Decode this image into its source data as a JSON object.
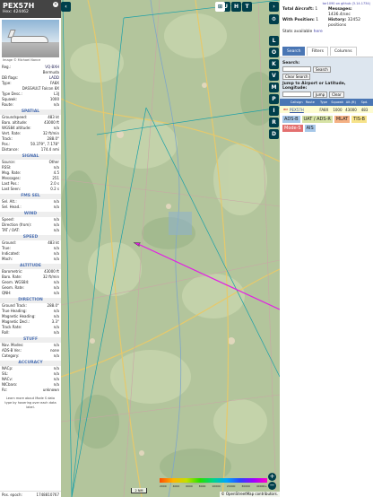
{
  "info": {
    "callsign": "PEX57H",
    "hex_label": "Hex:",
    "hex": "424462",
    "close_glyph": "×",
    "photo_credit": "Image © Michael Nance",
    "rows_top": [
      {
        "l": "Reg.:",
        "v": "VQ-BXH"
      },
      {
        "l": "",
        "v": "Bermuda"
      },
      {
        "l": "DB flags:",
        "v": "LADD"
      },
      {
        "l": "Type:",
        "v": "FA8X"
      },
      {
        "l": "",
        "v": "DASSAULT Falcon 8X"
      },
      {
        "l": "Type Desc.:",
        "v": "L3J"
      },
      {
        "l": "Squawk:",
        "v": "1000"
      },
      {
        "l": "Route:",
        "v": "n/a"
      }
    ],
    "sections": [
      {
        "title": "SPATIAL",
        "rows": [
          {
            "l": "Groundspeed:",
            "v": "483 kt"
          },
          {
            "l": "Baro. altitude:",
            "v": "43000 ft"
          },
          {
            "l": "WGS84 altitude:",
            "v": "n/a"
          },
          {
            "l": "Vert. Rate:",
            "v": "32 ft/min"
          },
          {
            "l": "Track:",
            "v": "288.0°"
          },
          {
            "l": "Pos.:",
            "v": "50.379°, 7.178°"
          },
          {
            "l": "Distance:",
            "v": "174.4 nmi"
          }
        ]
      },
      {
        "title": "SIGNAL",
        "rows": [
          {
            "l": "Source:",
            "v": "Other"
          },
          {
            "l": "RSSI:",
            "v": "n/a"
          },
          {
            "l": "Msg. Rate:",
            "v": "4.5"
          },
          {
            "l": "Messages:",
            "v": "251"
          },
          {
            "l": "Last Pos.:",
            "v": "2.0 s"
          },
          {
            "l": "Last Seen:",
            "v": "0.2 s"
          }
        ]
      },
      {
        "title": "FMS SEL",
        "rows": [
          {
            "l": "Sel. Alt.:",
            "v": "n/a"
          },
          {
            "l": "Sel. Head.:",
            "v": "n/a"
          }
        ]
      },
      {
        "title": "WIND",
        "rows": [
          {
            "l": "Speed:",
            "v": "n/a"
          },
          {
            "l": "Direction (from):",
            "v": "n/a"
          },
          {
            "l": "TAT / OAT:",
            "v": "n/a"
          }
        ]
      },
      {
        "title": "SPEED",
        "rows": [
          {
            "l": "Ground:",
            "v": "483 kt"
          },
          {
            "l": "True:",
            "v": "n/a"
          },
          {
            "l": "Indicated:",
            "v": "n/a"
          },
          {
            "l": "Mach:",
            "v": "n/a"
          }
        ]
      },
      {
        "title": "ALTITUDE",
        "rows": [
          {
            "l": "Barometric:",
            "v": "43000 ft"
          },
          {
            "l": "Baro. Rate:",
            "v": "32 ft/min"
          },
          {
            "l": "Geom. WGS84:",
            "v": "n/a"
          },
          {
            "l": "Geom. Rate:",
            "v": "n/a"
          },
          {
            "l": "QNH:",
            "v": "n/a"
          }
        ]
      },
      {
        "title": "DIRECTION",
        "rows": [
          {
            "l": "Ground Track:",
            "v": "288.0°"
          },
          {
            "l": "True Heading:",
            "v": "n/a"
          },
          {
            "l": "Magnetic Heading:",
            "v": "n/a"
          },
          {
            "l": "Magnetic Decl.:",
            "v": "3.3°"
          },
          {
            "l": "Track Rate:",
            "v": "n/a"
          },
          {
            "l": "Roll:",
            "v": "n/a"
          }
        ]
      },
      {
        "title": "STUFF",
        "rows": [
          {
            "l": "Nav. Modes:",
            "v": "n/a"
          },
          {
            "l": "ADS-B Ver.:",
            "v": "none"
          },
          {
            "l": "Category:",
            "v": "n/a"
          }
        ]
      },
      {
        "title": "ACCURACY",
        "rows": [
          {
            "l": "NACp:",
            "v": "n/a"
          },
          {
            "l": "SIL:",
            "v": "n/a"
          },
          {
            "l": "NACv:",
            "v": "n/a"
          },
          {
            "l": "NICbaro:",
            "v": "n/a"
          },
          {
            "l": "Rc:",
            "v": "unknown"
          }
        ]
      }
    ],
    "note": "Learn more about Mode S data type by hovering over each data label.",
    "foot_label": "Pos. epoch:",
    "foot_value": "1748810767"
  },
  "map": {
    "buttons_top": [
      "U",
      "H",
      "T"
    ],
    "buttons_right": [
      "L",
      "O",
      "K",
      "V",
      "M",
      "P",
      "I",
      "R",
      "D"
    ],
    "scale": "2 NM",
    "colorbar_labels": [
      "2000",
      "4000",
      "6000",
      "8000",
      "10000",
      "20000",
      "30000",
      "40000+"
    ],
    "attribution": "© OpenStreetMap contributors.",
    "zoom_in": "+",
    "zoom_out": "−",
    "colors": {
      "track": "#e21ee4",
      "route": "#1aa0a8"
    }
  },
  "side": {
    "top_link": "tar1090 on github (3.14.1734)",
    "stats": [
      {
        "k": "Total Aircraft:",
        "v": "1"
      },
      {
        "k": "Messages:",
        "v": "1436.4/sec"
      },
      {
        "k": "With Position:",
        "v": "1"
      },
      {
        "k": "History:",
        "v": "32452 positions"
      }
    ],
    "stats_available": "Stats available",
    "donate": "here",
    "tabs": [
      "Search",
      "Filters",
      "Columns"
    ],
    "search_label": "Search:",
    "search_button": "Search",
    "clear_search": "Clear Search",
    "jump_label": "Jump to Airport or Latitude, Longitude:",
    "jump_button": "Jump",
    "clear_button": "Clear",
    "columns": [
      "Callsign",
      "Route",
      "Type",
      "Squawk",
      "Alt.(ft)",
      "Spd."
    ],
    "row": {
      "flag": "BM",
      "callsign": "PEX57H",
      "type": "FA8X",
      "squawk": "1000",
      "alt": "43000",
      "spd": "483"
    },
    "badges": [
      "ADS-B",
      "UAT / ADS-R",
      "MLAT",
      "TIS-B",
      "Mode-S",
      "AIS"
    ]
  }
}
